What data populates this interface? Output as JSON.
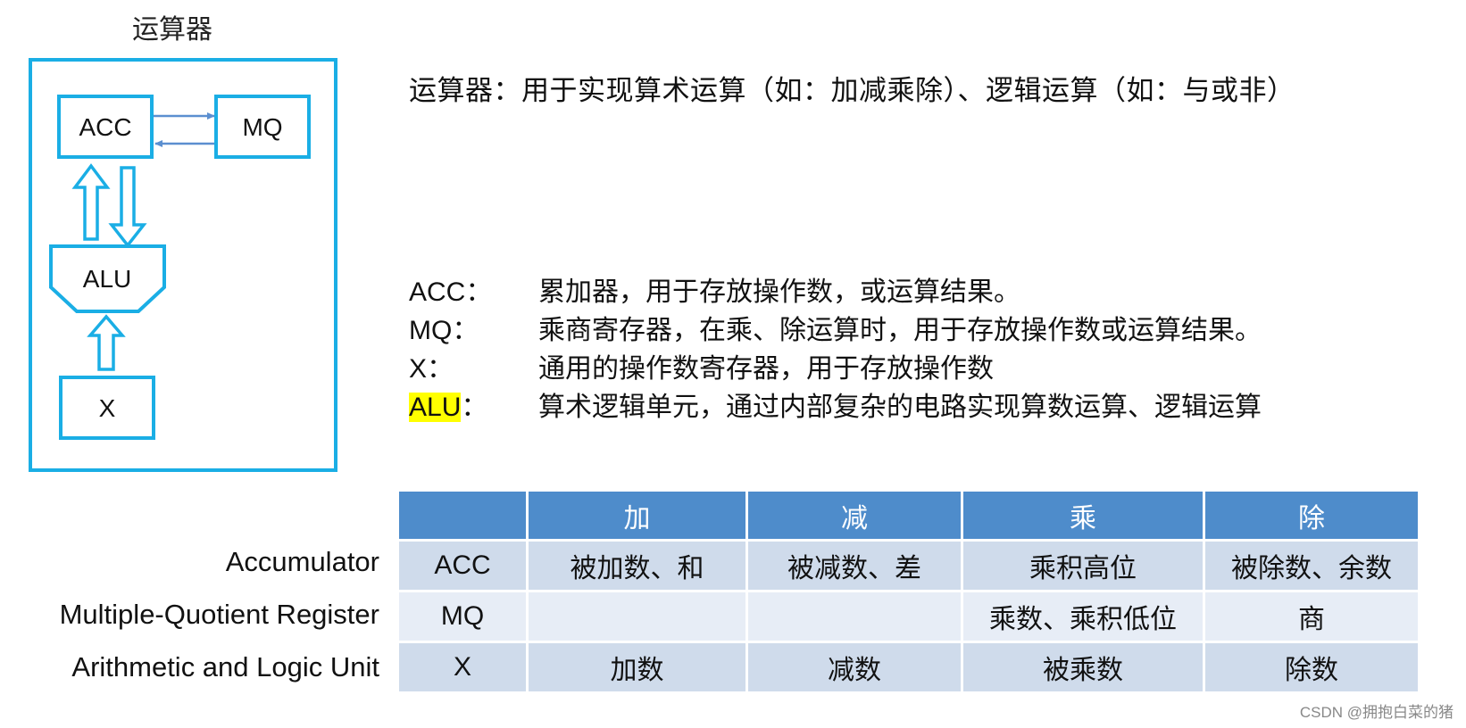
{
  "diagram": {
    "title": "运算器",
    "components": {
      "acc": "ACC",
      "mq": "MQ",
      "alu": "ALU",
      "x": "X"
    },
    "colors": {
      "frame": "#1aaee5",
      "bus_arrow": "#5b8fd0"
    },
    "connections": [
      {
        "from": "ACC",
        "to": "MQ",
        "type": "line-arrow"
      },
      {
        "from": "MQ",
        "to": "ACC",
        "type": "line-arrow"
      },
      {
        "from": "ALU",
        "to": "ACC",
        "type": "hollow-arrow"
      },
      {
        "from": "ACC",
        "to": "ALU",
        "type": "hollow-arrow"
      },
      {
        "from": "X",
        "to": "ALU",
        "type": "hollow-arrow"
      }
    ]
  },
  "intro": "运算器：用于实现算术运算（如：加减乘除）、逻辑运算（如：与或非）",
  "definitions": [
    {
      "term": "ACC",
      "sep": "：",
      "desc": "累加器，用于存放操作数，或运算结果。",
      "highlight": false
    },
    {
      "term": "MQ",
      "sep": "：",
      "desc": "乘商寄存器，在乘、除运算时，用于存放操作数或运算结果。",
      "highlight": false
    },
    {
      "term": "X",
      "sep": "：",
      "desc": "通用的操作数寄存器，用于存放操作数",
      "highlight": false
    },
    {
      "term": "ALU",
      "sep": "：",
      "desc": "算术逻辑单元，通过内部复杂的电路实现算数运算、逻辑运算",
      "highlight": true
    }
  ],
  "table": {
    "headers": [
      "",
      "加",
      "减",
      "乘",
      "除"
    ],
    "rows": [
      {
        "full_name": "Accumulator",
        "cells": [
          "ACC",
          "被加数、和",
          "被减数、差",
          "乘积高位",
          "被除数、余数"
        ]
      },
      {
        "full_name": "Multiple-Quotient Register",
        "cells": [
          "MQ",
          "",
          "",
          "乘数、乘积低位",
          "商"
        ]
      },
      {
        "full_name": "Arithmetic and Logic Unit",
        "cells": [
          "X",
          "加数",
          "减数",
          "被乘数",
          "除数"
        ]
      }
    ],
    "colors": {
      "header_bg": "#4e8ccb",
      "row_dark": "#cfdbeb",
      "row_light": "#e7edf6"
    }
  },
  "watermark": "CSDN @拥抱白菜的猪"
}
